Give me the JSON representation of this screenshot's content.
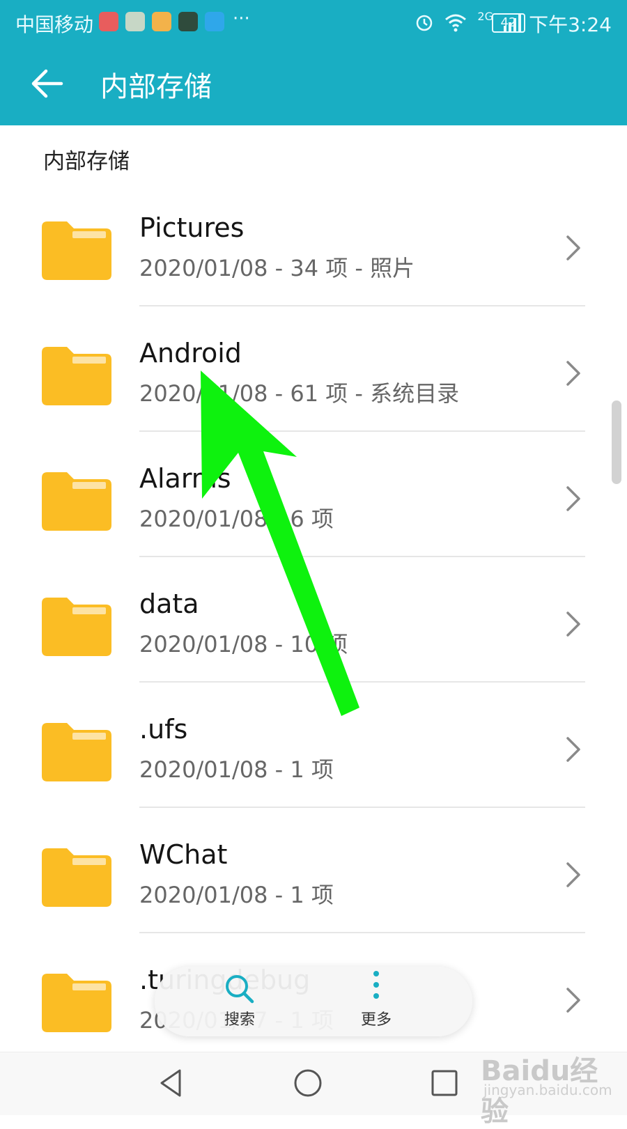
{
  "status_bar": {
    "carrier": "中国移动",
    "network": "2G",
    "battery": "42",
    "time": "下午3:24",
    "overflow": "···"
  },
  "header": {
    "title": "内部存储"
  },
  "breadcrumb": "内部存储",
  "items": [
    {
      "name": "Pictures",
      "meta": "2020/01/08 - 34 项 - 照片"
    },
    {
      "name": "Android",
      "meta": "2020/01/08 - 61 项 - 系统目录"
    },
    {
      "name": "Alarms",
      "meta": "2020/01/08 - 6 项"
    },
    {
      "name": "data",
      "meta": "2020/01/08 - 10 项"
    },
    {
      "name": ".ufs",
      "meta": "2020/01/08 - 1 项"
    },
    {
      "name": "WChat",
      "meta": "2020/01/08 - 1 项"
    },
    {
      "name": ".turingdebug",
      "meta": "2020/01/07 - 1 项"
    }
  ],
  "bottom_actions": {
    "search": "搜索",
    "more": "更多"
  },
  "watermark": {
    "brand": "Baidu经验",
    "url": "jingyan.baidu.com"
  },
  "colors": {
    "header": "#19aec3",
    "folder": "#fbbd24",
    "arrow": "#0ef20e"
  }
}
